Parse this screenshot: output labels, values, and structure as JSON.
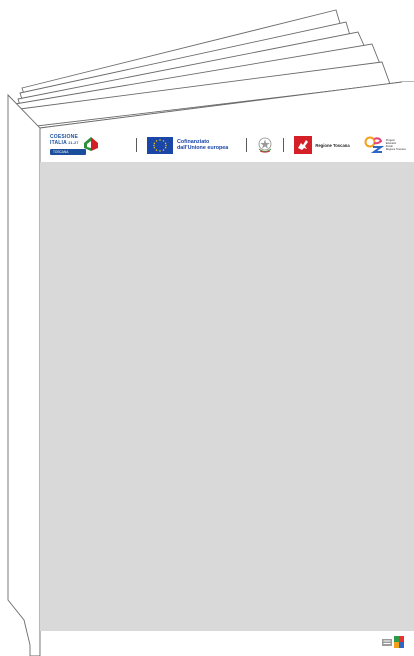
{
  "header_logos": {
    "coesione": {
      "line1": "COESIONE",
      "line2": "ITALIA",
      "period": "21-27",
      "region_pill": "TOSCANA"
    },
    "eu": {
      "line1": "Cofinanziato",
      "line2": "dall'Unione europea"
    },
    "regione": {
      "label": "Regione Toscana"
    },
    "pez": {
      "line1": "Progetti",
      "line2": "Educativi",
      "line3": "Zonali",
      "line4": "Regione Toscana"
    }
  },
  "colors": {
    "panel": "#d9d9d9",
    "eu_blue": "#1a46a8",
    "coesione_blue": "#1b4f9c",
    "toscana_red": "#d51f26"
  }
}
